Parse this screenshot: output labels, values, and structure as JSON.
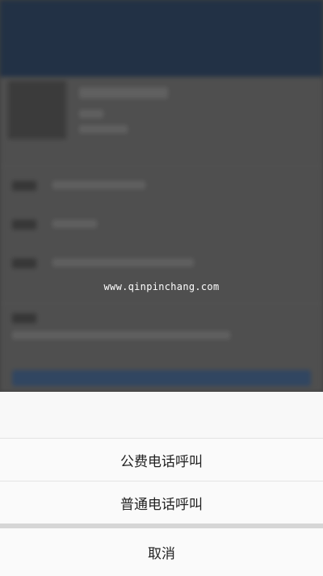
{
  "watermark": "www.qinpinchang.com",
  "action_sheet": {
    "options": [
      {
        "label": "公费电话呼叫"
      },
      {
        "label": "普通电话呼叫"
      }
    ],
    "cancel_label": "取消"
  },
  "colors": {
    "header": "#27384f",
    "dim_background": "#4a4a4a",
    "sheet_background": "#f8f8f8",
    "separator": "#e3e3e3"
  }
}
